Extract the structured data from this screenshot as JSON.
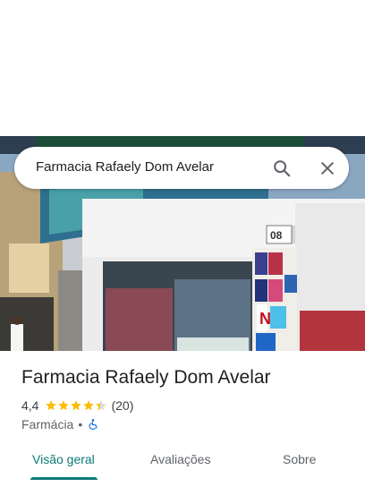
{
  "search": {
    "query": "Farmacia Rafaely Dom Avelar"
  },
  "photo": {
    "storefront_number": "08"
  },
  "place": {
    "name": "Farmacia Rafaely Dom Avelar",
    "rating": "4,4",
    "rating_value": 4.4,
    "review_count": "(20)",
    "category": "Farmácia",
    "separator": "•"
  },
  "tabs": [
    {
      "label": "Visão geral",
      "active": true
    },
    {
      "label": "Avaliações",
      "active": false
    },
    {
      "label": "Sobre",
      "active": false
    }
  ],
  "colors": {
    "accent": "#0b7a78",
    "star": "#fbbc04",
    "accessibility": "#1a73e8"
  },
  "icons": [
    "search-icon",
    "close-icon",
    "star-icon",
    "wheelchair-icon"
  ]
}
